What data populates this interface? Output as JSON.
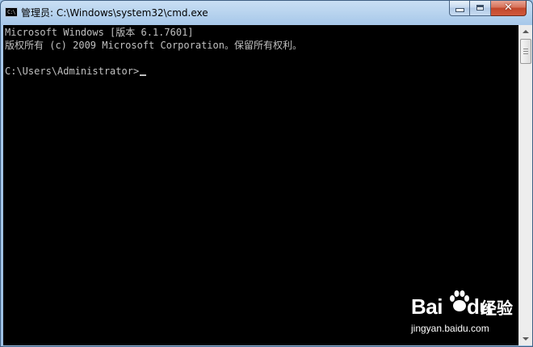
{
  "window": {
    "title": "管理员: C:\\Windows\\system32\\cmd.exe",
    "icon": "cmd-icon",
    "icon_text": "C:\\"
  },
  "controls": {
    "minimize_icon": "minimize-icon",
    "maximize_icon": "maximize-icon",
    "close_icon": "close-icon",
    "close_glyph": "✕"
  },
  "console": {
    "lines": [
      "Microsoft Windows [版本 6.1.7601]",
      "版权所有 (c) 2009 Microsoft Corporation。保留所有权利。",
      "",
      "C:\\Users\\Administrator>"
    ]
  },
  "watermark": {
    "logo_text": "Bai",
    "logo_text2": "du",
    "suffix": "经验",
    "url": "jingyan.baidu.com"
  },
  "colors": {
    "console_bg": "#000000",
    "console_fg": "#c0c0c0",
    "titlebar": "#a9c9ea",
    "close_button": "#c2472b"
  }
}
